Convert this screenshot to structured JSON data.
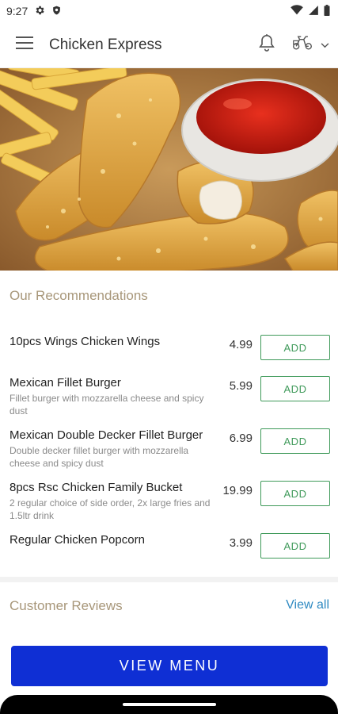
{
  "status_bar": {
    "time": "9:27",
    "left_icons": [
      "settings-gear-icon",
      "shield-icon"
    ],
    "right_icons": [
      "wifi-icon",
      "cell-signal-icon",
      "battery-icon"
    ]
  },
  "app_bar": {
    "title": "Chicken Express",
    "icons": [
      "hamburger-menu-icon",
      "bell-icon",
      "scooter-icon",
      "chevron-down-icon"
    ]
  },
  "hero": {
    "subject": "crispy chicken tenders with fries and ketchup"
  },
  "recommendations": {
    "title": "Our Recommendations",
    "add_label": "ADD",
    "items": [
      {
        "name": "10pcs Wings Chicken Wings",
        "description": "",
        "price": "4.99"
      },
      {
        "name": "Mexican Fillet Burger",
        "description": "Fillet burger with mozzarella cheese and spicy dust",
        "price": "5.99"
      },
      {
        "name": "Mexican Double Decker Fillet Burger",
        "description": "Double decker fillet burger with mozzarella cheese and spicy dust",
        "price": "6.99"
      },
      {
        "name": "8pcs Rsc Chicken Family Bucket",
        "description": "2 regular choice of side order, 2x large fries and 1.5ltr drink",
        "price": "19.99"
      },
      {
        "name": "Regular Chicken Popcorn",
        "description": "",
        "price": "3.99"
      }
    ]
  },
  "reviews": {
    "title": "Customer Reviews",
    "view_all_label": "View all"
  },
  "footer": {
    "view_menu_label": "VIEW MENU"
  },
  "colors": {
    "accent_gold": "#a8977a",
    "add_green": "#3f9a5a",
    "link_blue": "#2f8ac2",
    "primary_button": "#0f2fd4"
  }
}
